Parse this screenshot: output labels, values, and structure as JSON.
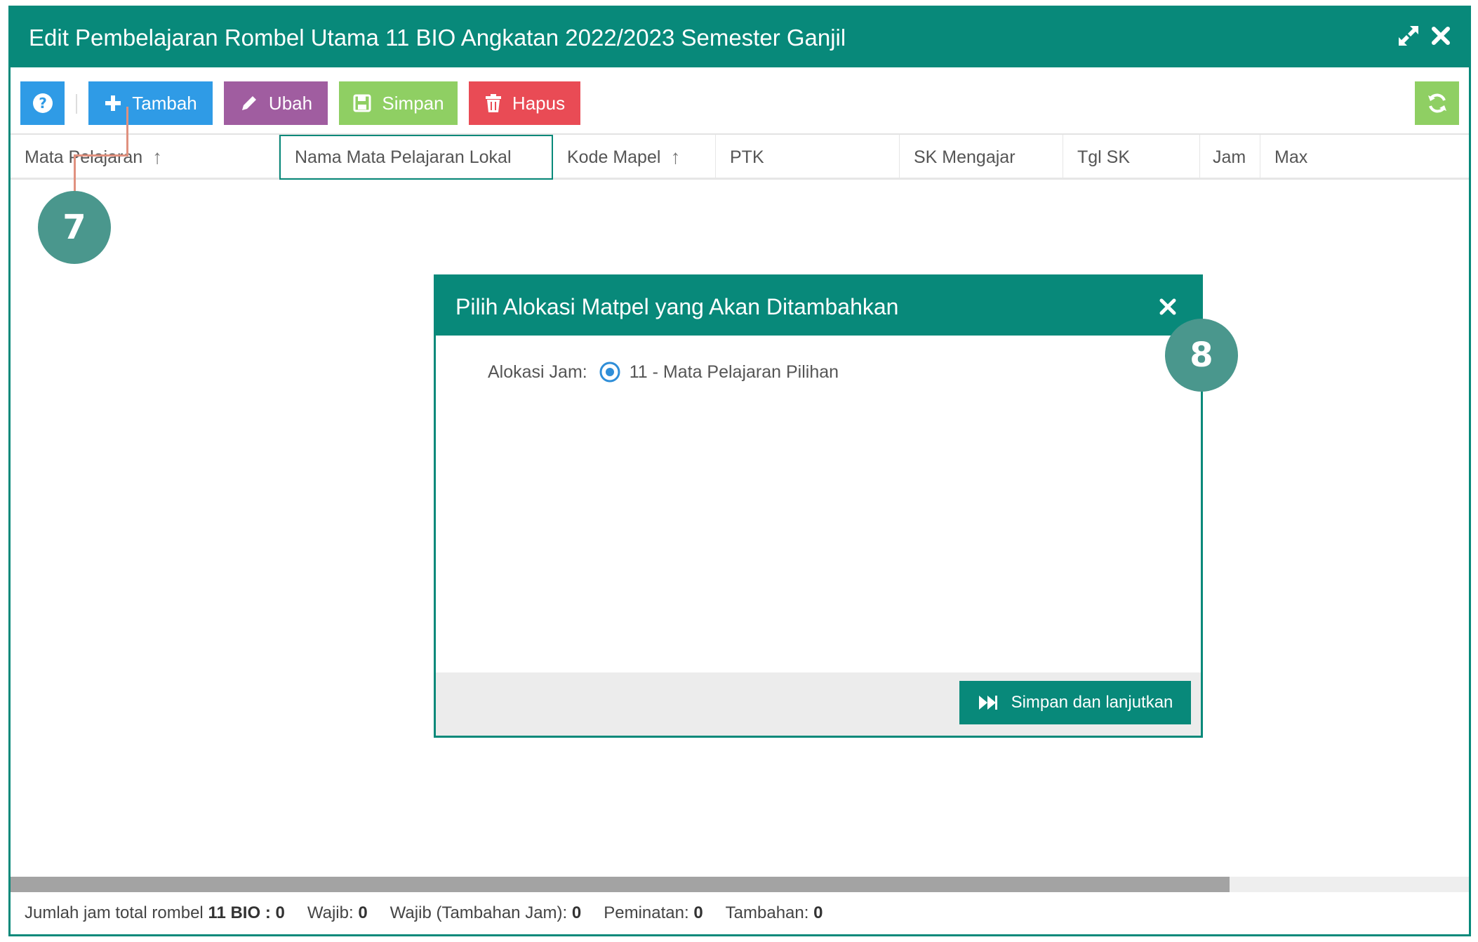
{
  "window": {
    "title": "Edit Pembelajaran Rombel Utama 11 BIO Angkatan 2022/2023 Semester Ganjil"
  },
  "toolbar": {
    "help_icon": "question-circle-icon",
    "tambah_label": "Tambah",
    "ubah_label": "Ubah",
    "simpan_label": "Simpan",
    "hapus_label": "Hapus",
    "refresh_icon": "refresh-icon"
  },
  "table": {
    "columns": [
      {
        "label": "Mata Pelajaran",
        "sortable": true
      },
      {
        "label": "Nama Mata Pelajaran Lokal",
        "sortable": false
      },
      {
        "label": "Kode Mapel",
        "sortable": true
      },
      {
        "label": "PTK",
        "sortable": false
      },
      {
        "label": "SK Mengajar",
        "sortable": false
      },
      {
        "label": "Tgl SK",
        "sortable": false
      },
      {
        "label": "Jam",
        "sortable": false
      },
      {
        "label": "Max",
        "sortable": false
      }
    ],
    "sort_glyph": "↑"
  },
  "footer": {
    "total_prefix": "Jumlah jam total rombel",
    "rombel": "11 BIO",
    "total_value": ": 0",
    "wajib_label": "Wajib:",
    "wajib_value": "0",
    "wajib_tambahan_label": "Wajib (Tambahan Jam):",
    "wajib_tambahan_value": "0",
    "peminatan_label": "Peminatan:",
    "peminatan_value": "0",
    "tambahan_label": "Tambahan:",
    "tambahan_value": "0"
  },
  "modal": {
    "title": "Pilih Alokasi Matpel yang Akan Ditambahkan",
    "alokasi_label": "Alokasi Jam:",
    "alokasi_option": "11 - Mata Pelajaran Pilihan",
    "alokasi_selected": true,
    "continue_label": "Simpan dan lanjutkan"
  },
  "callouts": {
    "step_7": "7",
    "step_8": "8"
  },
  "colors": {
    "primary_teal": "#08897a",
    "blue": "#2f9be6",
    "purple": "#a05da0",
    "green": "#8fcf63",
    "red": "#e94b55",
    "callout": "#4a978d",
    "leader": "#e0917f"
  }
}
